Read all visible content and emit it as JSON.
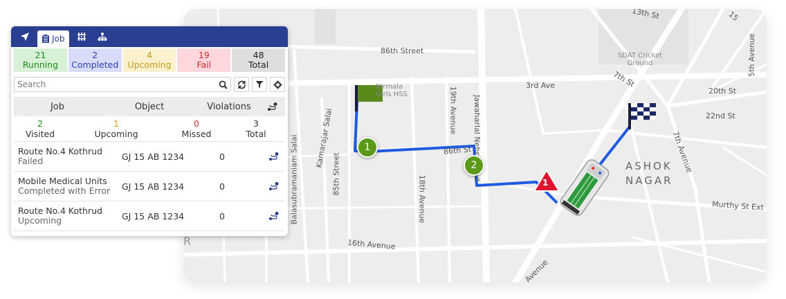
{
  "panel": {
    "tabs": [
      {
        "icon": "navigate-icon",
        "label": ""
      },
      {
        "icon": "clipboard-icon",
        "label": "Job"
      },
      {
        "icon": "road-icon",
        "label": ""
      },
      {
        "icon": "hierarchy-icon",
        "label": ""
      }
    ],
    "status": {
      "running": {
        "count": "21",
        "label": "Running"
      },
      "completed": {
        "count": "2",
        "label": "Completed"
      },
      "upcoming": {
        "count": "4",
        "label": "Upcoming"
      },
      "fail": {
        "count": "19",
        "label": "Fail"
      },
      "total": {
        "count": "48",
        "label": "Total"
      }
    },
    "search": {
      "placeholder": "Search"
    },
    "table": {
      "headers": {
        "job": "Job",
        "object": "Object",
        "violations": "Violations"
      },
      "summary": {
        "visited": {
          "count": "2",
          "label": "Visited"
        },
        "upcoming": {
          "count": "1",
          "label": "Upcoming"
        },
        "missed": {
          "count": "0",
          "label": "Missed"
        },
        "total": {
          "count": "3",
          "label": "Total"
        }
      },
      "rows": [
        {
          "job": "Route No.4 Kothrud",
          "status": "Failed",
          "object": "GJ 15 AB 1234",
          "violations": "0"
        },
        {
          "job": "Mobile Medical Units",
          "status": "Completed with Error",
          "object": "GJ 15 AB 1234",
          "violations": "0"
        },
        {
          "job": "Route No.4 Kothrud",
          "status": "Upcoming",
          "object": "GJ 15 AB 1234",
          "violations": "0"
        }
      ]
    }
  },
  "map": {
    "labels": {
      "street_13th": "13th St",
      "street_86th": "86th Street",
      "street_3rd_ave": "3rd Ave",
      "street_7th": "7th St",
      "street_20th": "20th St",
      "street_22nd": "22nd St",
      "ave_5th": "5th Avenue",
      "ave_7th": "7th Avenue",
      "sdat": "SDAT Cricket Ground",
      "school": "Nirmala Girls HSS",
      "ave_19th": "19th Avenue",
      "jawaharlal": "Jawaharlal Nehru Road",
      "st_86th_small": "86th St",
      "ashok": "ASHOK NAGAR",
      "murthy": "Murthy St Ext",
      "subramaniam": "Balasubramaniam Salai",
      "kamarajar": "Kamarajar Salai",
      "street_85th": "85th Street",
      "ave_18th": "18th Avenue",
      "ave_16th": "16th Avenue",
      "avenue": "Avenue",
      "cut_r": "R"
    },
    "markers": {
      "stop1": "1",
      "stop2": "2",
      "violation": "1"
    },
    "colors": {
      "route": "#1f5ae0",
      "marker": "#5a9a18",
      "warning": "#e0142e",
      "start_flag": "#5a8a1a"
    }
  }
}
